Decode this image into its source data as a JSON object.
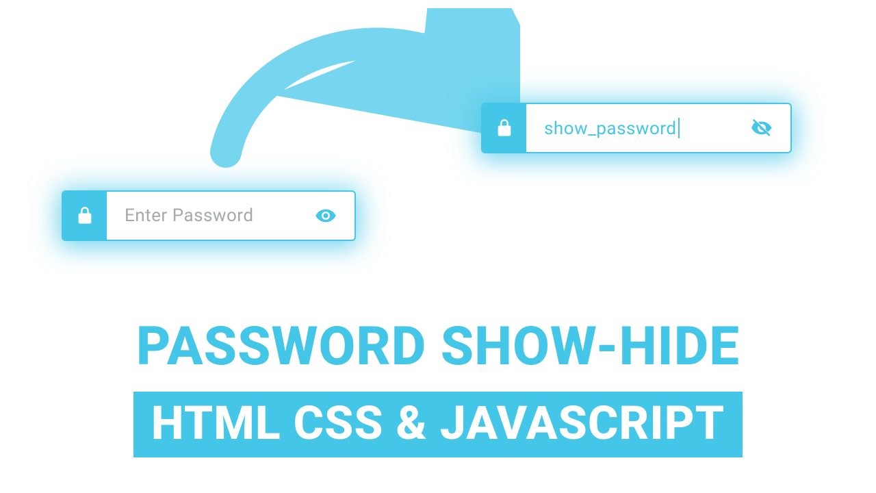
{
  "colors": {
    "accent": "#43c6e8"
  },
  "boxA": {
    "placeholder": "Enter Password",
    "value": "",
    "eye_state": "show"
  },
  "boxB": {
    "placeholder": "",
    "value": "show_password",
    "eye_state": "hide"
  },
  "titles": {
    "line1": "PASSWORD SHOW-HIDE",
    "line2": "HTML CSS & JAVASCRIPT"
  }
}
